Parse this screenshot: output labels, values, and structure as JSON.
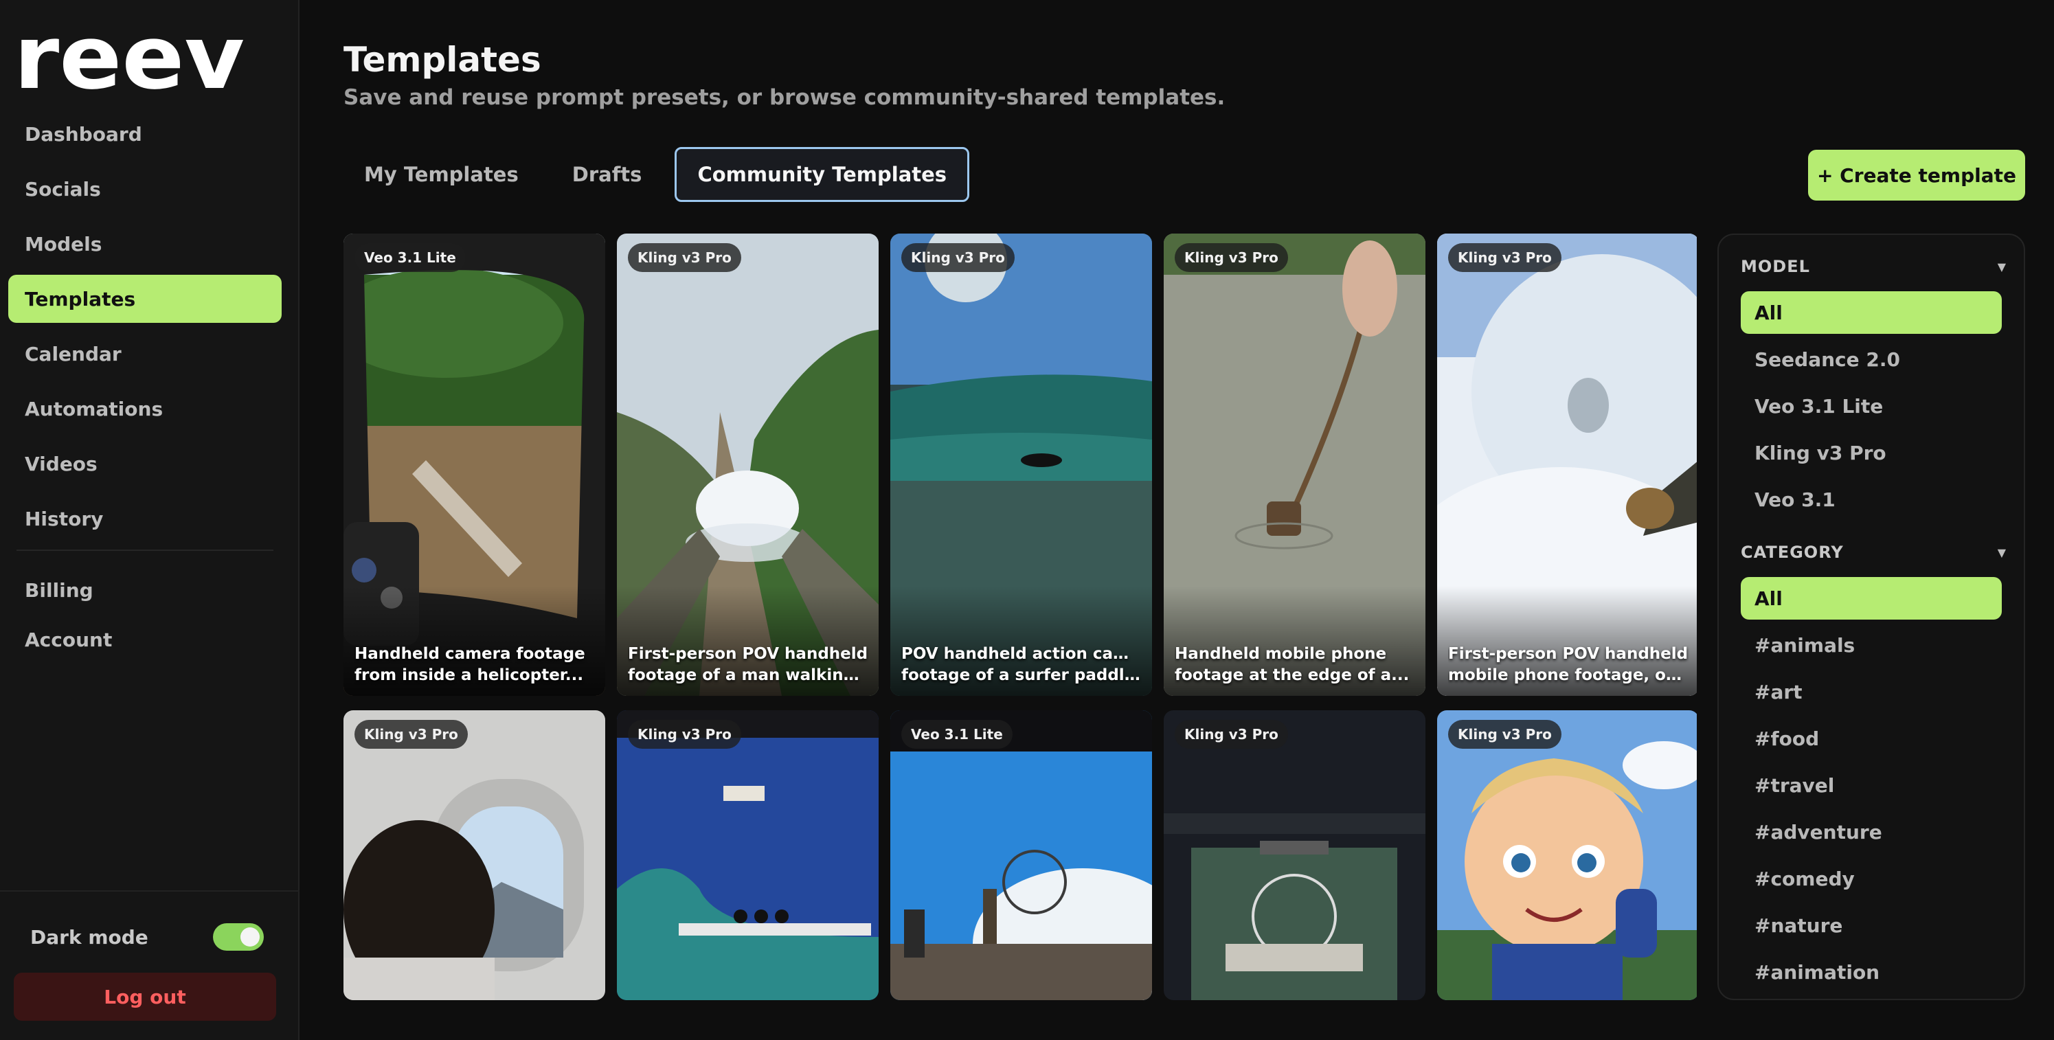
{
  "app": {
    "logo_text": "reev"
  },
  "sidebar": {
    "items": [
      {
        "label": "Dashboard",
        "active": false
      },
      {
        "label": "Socials",
        "active": false
      },
      {
        "label": "Models",
        "active": false
      },
      {
        "label": "Templates",
        "active": true
      },
      {
        "label": "Calendar",
        "active": false
      },
      {
        "label": "Automations",
        "active": false
      },
      {
        "label": "Videos",
        "active": false
      },
      {
        "label": "History",
        "active": false
      }
    ],
    "secondary_items": [
      {
        "label": "Billing"
      },
      {
        "label": "Account"
      }
    ],
    "dark_mode_label": "Dark mode",
    "dark_mode_on": true,
    "logout_label": "Log out"
  },
  "page": {
    "title": "Templates",
    "subtitle": "Save and reuse prompt presets, or browse community-shared templates."
  },
  "tabs": [
    {
      "label": "My Templates",
      "active": false
    },
    {
      "label": "Drafts",
      "active": false
    },
    {
      "label": "Community Templates",
      "active": true
    }
  ],
  "create_button_label": "+ Create template",
  "templates": [
    {
      "model": "Veo 3.1 Lite",
      "caption": [
        "Handheld camera footage",
        "from inside a helicopter..."
      ],
      "scene": "helicopter-river"
    },
    {
      "model": "Kling v3 Pro",
      "caption": [
        "First-person POV handheld",
        "footage of a man walking o..."
      ],
      "scene": "cloud-in-hands"
    },
    {
      "model": "Kling v3 Pro",
      "caption": [
        "POV handheld action camera",
        "footage of a surfer paddlin..."
      ],
      "scene": "surfer-wave"
    },
    {
      "model": "Kling v3 Pro",
      "caption": [
        "Handheld mobile phone",
        "footage at the edge of a..."
      ],
      "scene": "rope-water"
    },
    {
      "model": "Kling v3 Pro",
      "caption": [
        "First-person POV handheld",
        "mobile phone footage, one..."
      ],
      "scene": "snow-creature"
    },
    {
      "model": "Kling v3 Pro",
      "caption": [
        "",
        ""
      ],
      "scene": "airplane-window"
    },
    {
      "model": "Kling v3 Pro",
      "caption": [
        "",
        ""
      ],
      "scene": "studio-wave"
    },
    {
      "model": "Veo 3.1 Lite",
      "caption": [
        "",
        ""
      ],
      "scene": "london-miniature"
    },
    {
      "model": "Kling v3 Pro",
      "caption": [
        "",
        ""
      ],
      "scene": "pool-set"
    },
    {
      "model": "Kling v3 Pro",
      "caption": [
        "",
        ""
      ],
      "scene": "cartoon-kid"
    }
  ],
  "filters": {
    "model": {
      "title": "MODEL",
      "options": [
        {
          "label": "All",
          "active": true
        },
        {
          "label": "Seedance 2.0",
          "active": false
        },
        {
          "label": "Veo 3.1 Lite",
          "active": false
        },
        {
          "label": "Kling v3 Pro",
          "active": false
        },
        {
          "label": "Veo 3.1",
          "active": false
        }
      ]
    },
    "category": {
      "title": "CATEGORY",
      "options": [
        {
          "label": "All",
          "active": true
        },
        {
          "label": "#animals",
          "active": false
        },
        {
          "label": "#art",
          "active": false
        },
        {
          "label": "#food",
          "active": false
        },
        {
          "label": "#travel",
          "active": false
        },
        {
          "label": "#adventure",
          "active": false
        },
        {
          "label": "#comedy",
          "active": false
        },
        {
          "label": "#nature",
          "active": false
        },
        {
          "label": "#animation",
          "active": false
        }
      ]
    }
  },
  "colors": {
    "accent": "#b6ec72",
    "background": "#0e0e0e",
    "sidebar": "#151515",
    "danger": "#ff5f5f"
  }
}
